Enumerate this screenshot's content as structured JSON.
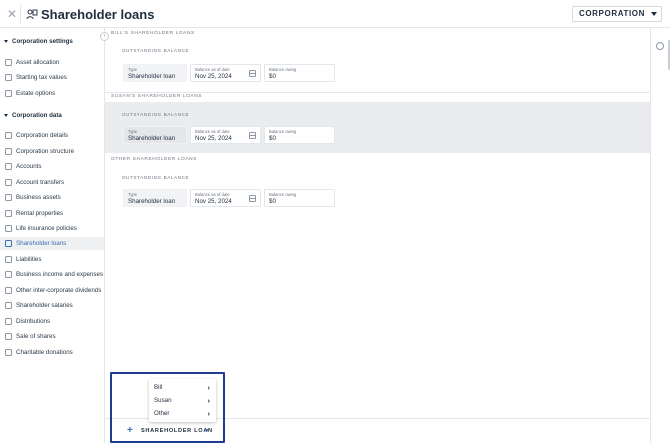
{
  "header": {
    "title": "Shareholder loans",
    "corporation_label": "CORPORATION"
  },
  "sidebar": {
    "sections": [
      {
        "label": "Corporation settings",
        "items": [
          {
            "label": "Asset allocation",
            "icon": "pie-icon"
          },
          {
            "label": "Starting tax values",
            "icon": "calculator-icon"
          },
          {
            "label": "Estate options",
            "icon": "document-icon"
          }
        ]
      },
      {
        "label": "Corporation data",
        "items": [
          {
            "label": "Corporation details",
            "icon": "info-icon"
          },
          {
            "label": "Corporation structure",
            "icon": "structure-icon"
          },
          {
            "label": "Accounts",
            "icon": "bank-icon"
          },
          {
            "label": "Account transfers",
            "icon": "transfer-icon"
          },
          {
            "label": "Business assets",
            "icon": "building-icon"
          },
          {
            "label": "Rental properties",
            "icon": "house-icon"
          },
          {
            "label": "Life insurance policies",
            "icon": "umbrella-icon"
          },
          {
            "label": "Shareholder loans",
            "icon": "loan-icon",
            "active": true
          },
          {
            "label": "Liabilities",
            "icon": "liability-icon"
          },
          {
            "label": "Business income and expenses",
            "icon": "income-icon"
          },
          {
            "label": "Other inter-corporate dividends",
            "icon": "dividend-icon"
          },
          {
            "label": "Shareholder salaries",
            "icon": "salary-icon"
          },
          {
            "label": "Distributions",
            "icon": "distribution-icon"
          },
          {
            "label": "Sale of shares",
            "icon": "sale-icon"
          },
          {
            "label": "Charitable donations",
            "icon": "donation-icon"
          }
        ]
      }
    ]
  },
  "groups": [
    {
      "header": "BILL'S SHAREHOLDER LOANS",
      "subheader": "OUTSTANDING BALANCE",
      "type_label": "Type",
      "type_value": "Shareholder loan",
      "date_label": "Balance as of date",
      "date_value": "Nov 25, 2024",
      "owing_label": "Balance owing",
      "owing_value": "$0"
    },
    {
      "header": "SUSAN'S SHAREHOLDER LOANS",
      "subheader": "OUTSTANDING BALANCE",
      "type_label": "Type",
      "type_value": "Shareholder loan",
      "date_label": "Balance as of date",
      "date_value": "Nov 25, 2024",
      "owing_label": "Balance owing",
      "owing_value": "$0"
    },
    {
      "header": "OTHER SHAREHOLDER LOANS",
      "subheader": "OUTSTANDING BALANCE",
      "type_label": "Type",
      "type_value": "Shareholder loan",
      "date_label": "Balance as of date",
      "date_value": "Nov 25, 2024",
      "owing_label": "Balance owing",
      "owing_value": "$0"
    }
  ],
  "menu": {
    "items": [
      "Bill",
      "Susan",
      "Other"
    ]
  },
  "footer": {
    "add_label": "SHAREHOLDER LOAN"
  },
  "colors": {
    "accent": "#3d6fb5",
    "highlight": "#1f3c8f",
    "active_bg": "#eef0f2"
  }
}
